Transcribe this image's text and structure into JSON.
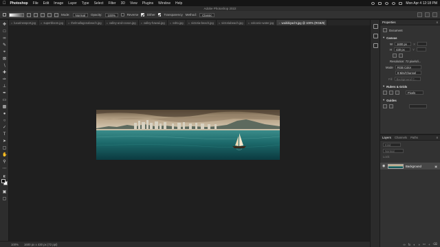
{
  "menubar": {
    "app": "Photoshop",
    "items": [
      "File",
      "Edit",
      "Image",
      "Layer",
      "Type",
      "Select",
      "Filter",
      "3D",
      "View",
      "Plugins",
      "Window",
      "Help"
    ],
    "clock": "Mon Apr 4  12:18 PM"
  },
  "window_title": "Adobe Photoshop 2022",
  "options": {
    "mode_label": "Mode:",
    "mode_value": "Normal",
    "opacity_label": "Opacity:",
    "opacity_value": "100%",
    "reverse_label": "Reverse",
    "dither_label": "Dither",
    "transparency_label": "Transparency",
    "method_label": "Method:",
    "method_value": "Classic"
  },
  "tabs": [
    {
      "label": "luxurinewport.jpg",
      "active": false
    },
    {
      "label": "superbloom.jpg",
      "active": false
    },
    {
      "label": "thelmallagonabeach.jpg",
      "active": false
    },
    {
      "label": "valley-and-ocean.jpg",
      "active": false
    },
    {
      "label": "valley-hawaii.jpg",
      "active": false
    },
    {
      "label": "volto.jpg",
      "active": false
    },
    {
      "label": "victoria-beach.jpg",
      "active": false
    },
    {
      "label": "victoriabeach.jpg",
      "active": false
    },
    {
      "label": "volcanic-water.jpg",
      "active": false
    },
    {
      "label": "waikikiyacht.jpg @ 100% (RGB/8)",
      "active": true
    }
  ],
  "status": {
    "zoom": "100%",
    "doc_info": "1600 px x 430 px (72 ppi)"
  },
  "properties": {
    "tabs": [
      "Properties"
    ],
    "doc_type": "Document",
    "canvas_heading": "Canvas",
    "width_label": "W",
    "width_value": "1600 px",
    "height_label": "H",
    "height_value": "430 px",
    "x_label": "X",
    "y_label": "Y",
    "resolution": "Resolution: 72 pixels/i...",
    "mode_label": "Mode",
    "mode_value": "RGB Color",
    "bits_value": "8 Bits/Channel",
    "fill_label": "Fill",
    "fill_value": "Background C...",
    "rulers_heading": "Rulers & Grids",
    "units_value": "Pixels",
    "guides_heading": "Guides"
  },
  "layers": {
    "tabs": [
      "Layers",
      "Channels",
      "Paths"
    ],
    "kind_placeholder": "Kind",
    "blend": "Normal",
    "lock_label": "Lock:",
    "layer_name": "Background"
  },
  "colors": {
    "foreground": "#000000",
    "background": "#ffffff"
  }
}
